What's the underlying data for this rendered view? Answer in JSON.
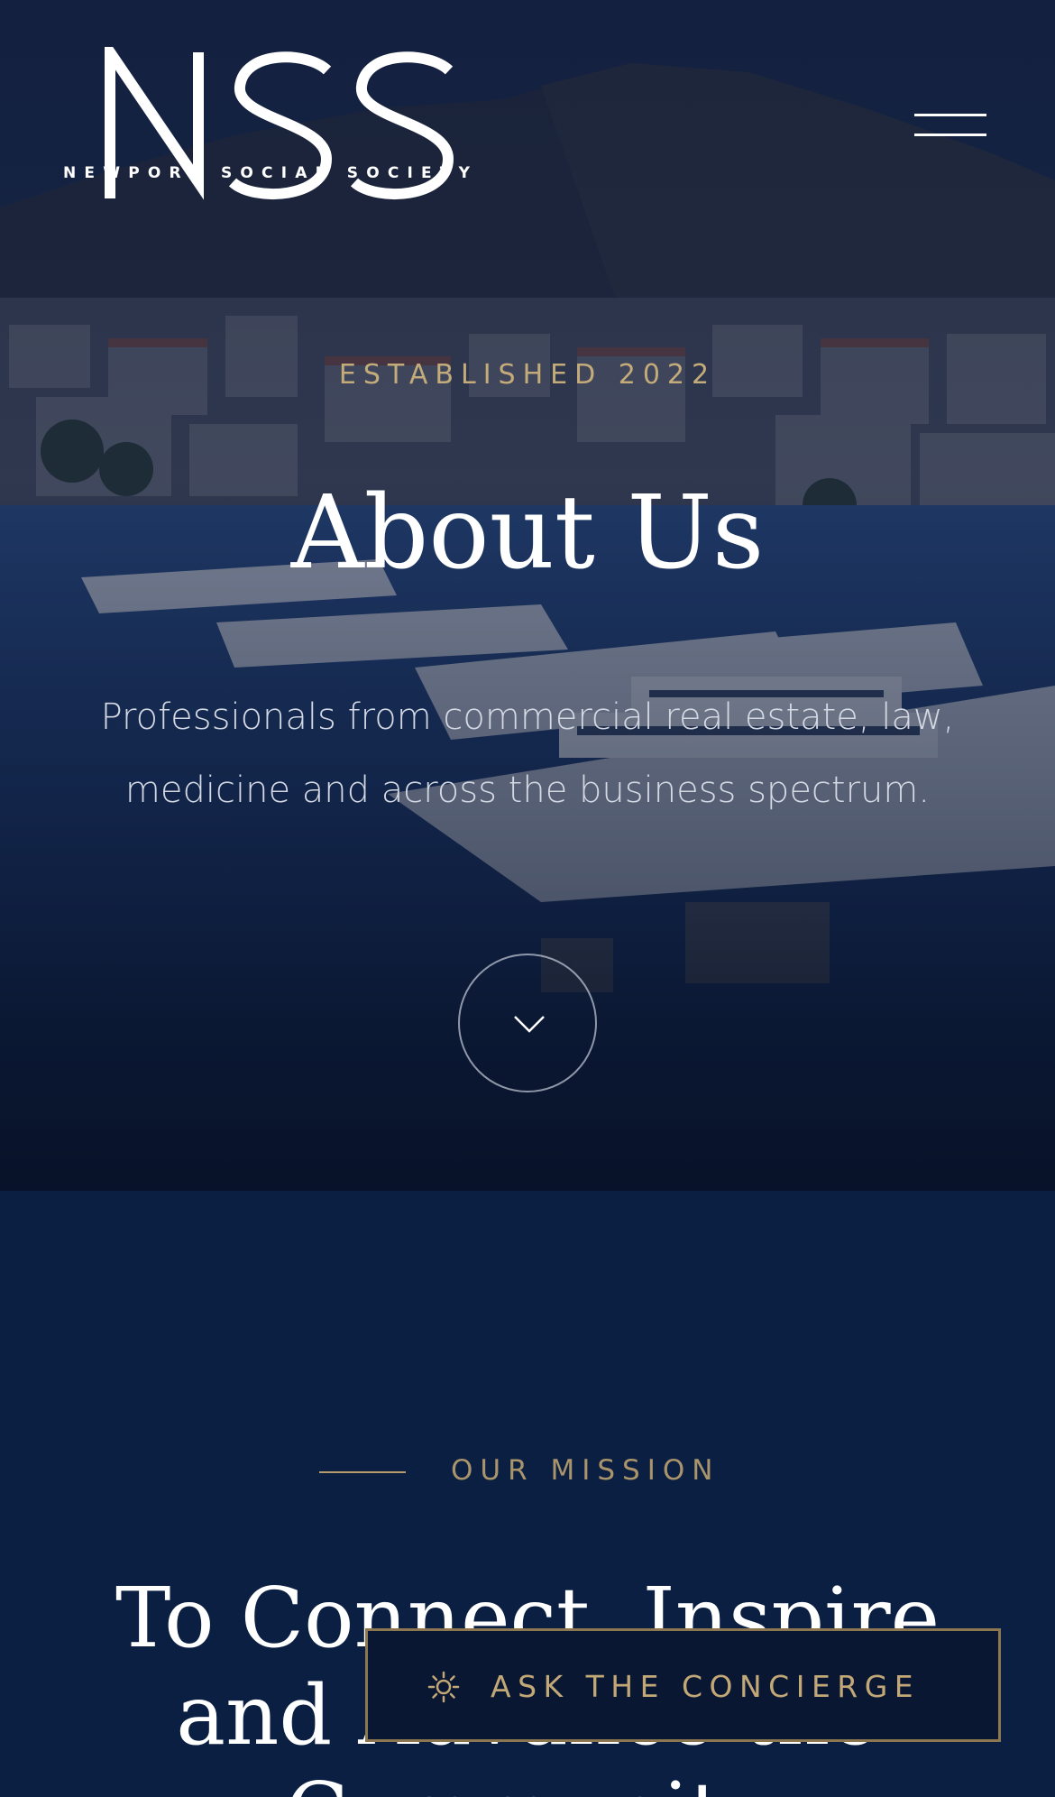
{
  "header": {
    "logo_letters": "NSS",
    "logo_subtitle": "NEWPORT SOCIAL SOCIETY",
    "menu_icon": "hamburger-menu-icon"
  },
  "hero": {
    "eyebrow": "ESTABLISHED 2022",
    "title": "About Us",
    "text": "Professionals from commercial real estate, law, medicine and across the business spectrum.",
    "scroll_icon": "chevron-down-icon",
    "background": "harbor-with-yachts-photo"
  },
  "mission": {
    "label": "OUR MISSION",
    "title": "To Connect, Inspire and Advance the Community"
  },
  "concierge": {
    "label": "ASK THE CONCIERGE",
    "icon": "sun-icon"
  },
  "colors": {
    "navy": "#0b1f42",
    "gold": "#c4ab7a",
    "white": "#ffffff"
  }
}
